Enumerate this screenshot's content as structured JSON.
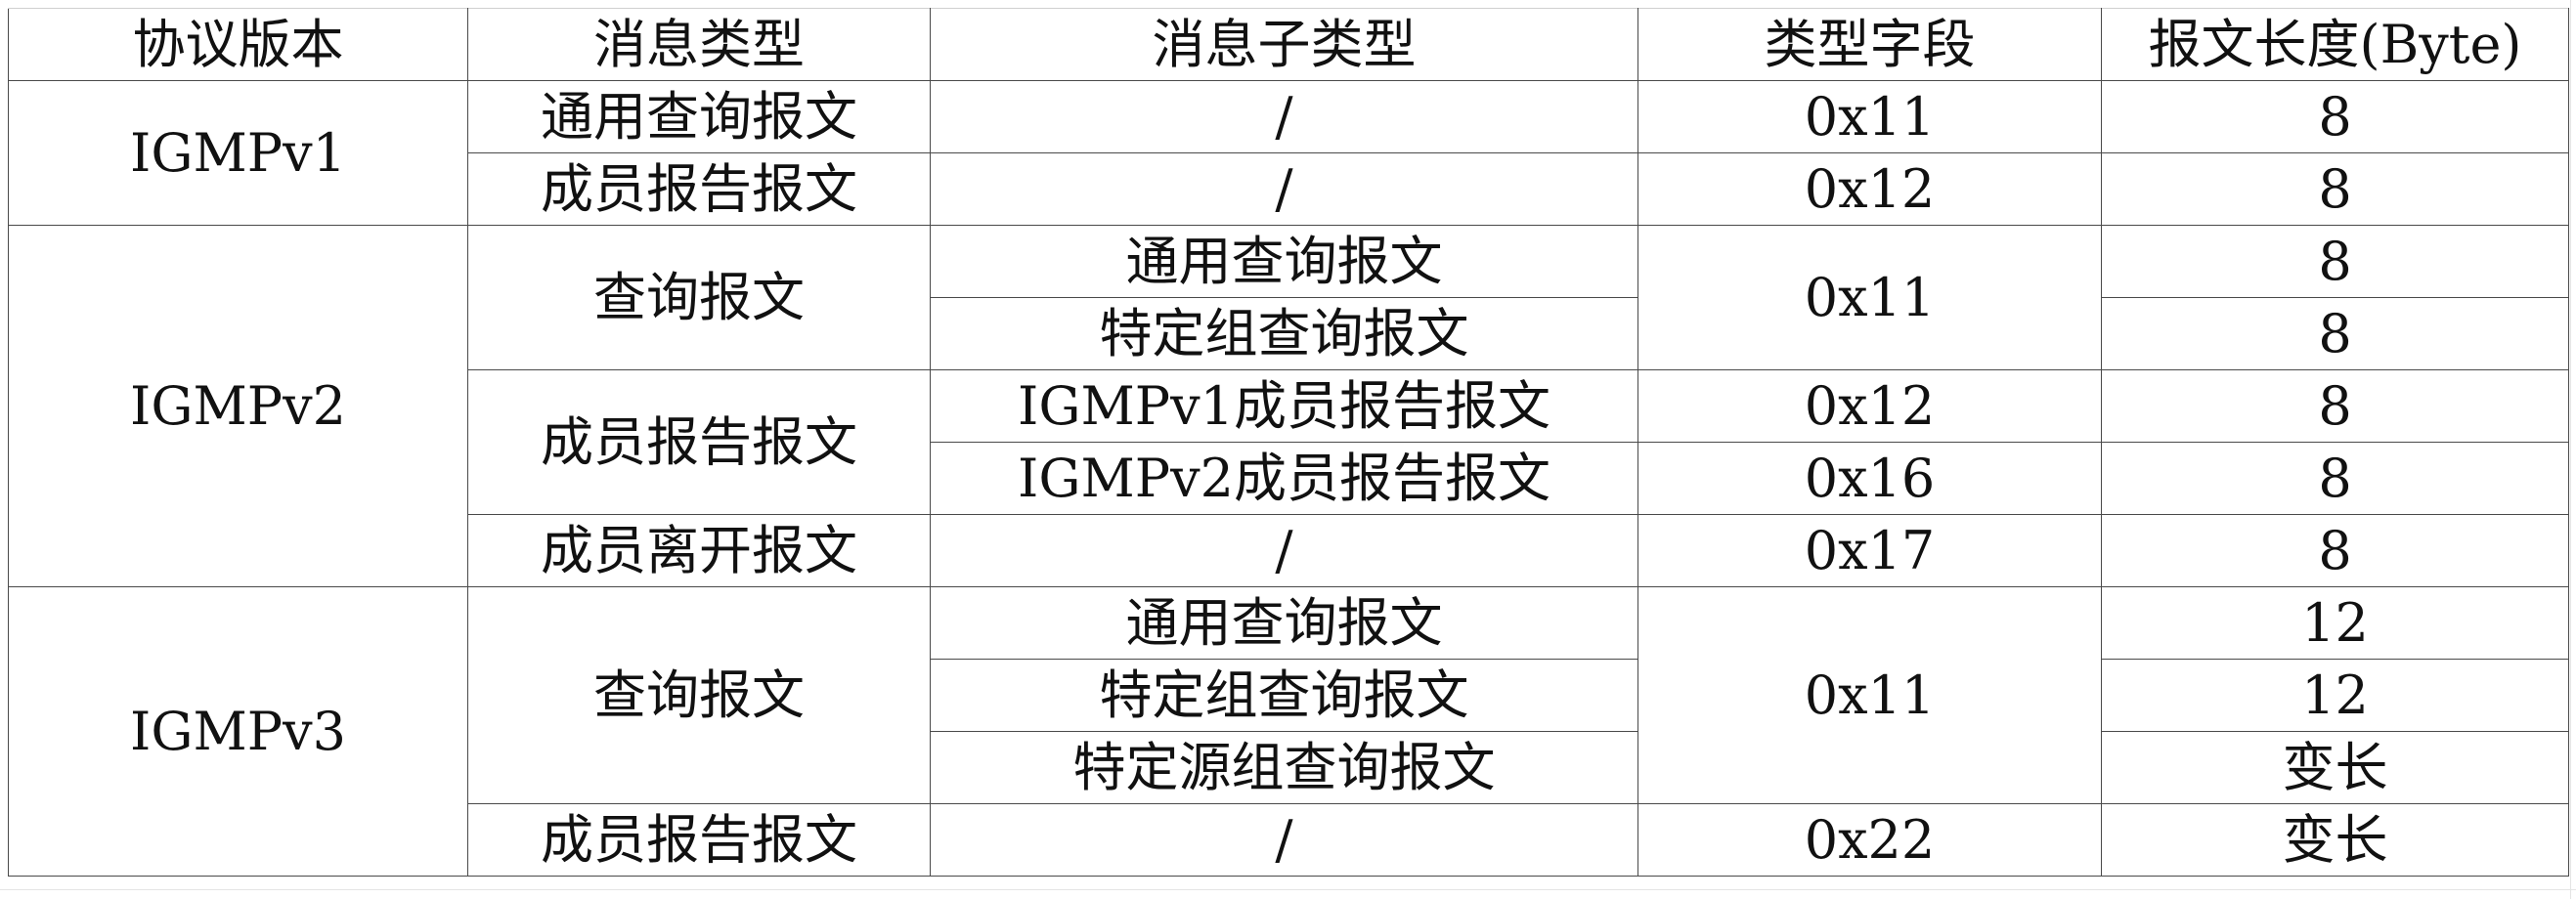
{
  "headers": [
    "协议版本",
    "消息类型",
    "消息子类型",
    "类型字段",
    "报文长度(Byte)"
  ],
  "rows": [
    {
      "version": "IGMPv1",
      "type": "通用查询报文",
      "subtype": "/",
      "field": "0x11",
      "length": "8"
    },
    {
      "type": "成员报告报文",
      "subtype": "/",
      "field": "0x12",
      "length": "8"
    },
    {
      "version": "IGMPv2",
      "type": "查询报文",
      "subtype": "通用查询报文",
      "field": "0x11",
      "length": "8"
    },
    {
      "subtype": "特定组查询报文",
      "length": "8"
    },
    {
      "type": "成员报告报文",
      "subtype": "IGMPv1成员报告报文",
      "field": "0x12",
      "length": "8"
    },
    {
      "subtype": "IGMPv2成员报告报文",
      "field": "0x16",
      "length": "8"
    },
    {
      "type": "成员离开报文",
      "subtype": "/",
      "field": "0x17",
      "length": "8"
    },
    {
      "version": "IGMPv3",
      "type": "查询报文",
      "subtype": "通用查询报文",
      "field": "0x11",
      "length": "12"
    },
    {
      "subtype": "特定组查询报文",
      "length": "12"
    },
    {
      "subtype": "特定源组查询报文",
      "length": "变长"
    },
    {
      "type": "成员报告报文",
      "subtype": "/",
      "field": "0x22",
      "length": "变长"
    }
  ]
}
